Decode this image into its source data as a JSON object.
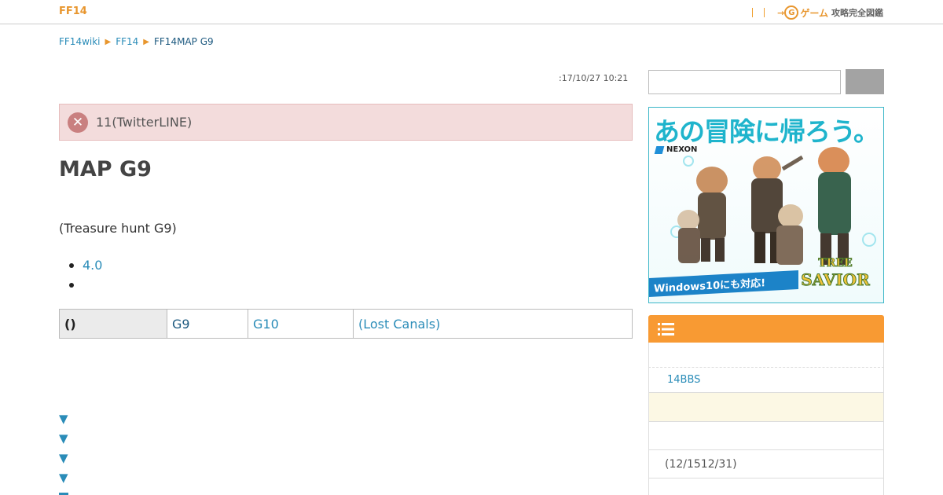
{
  "header": {
    "site_title": "FF14",
    "logo_text_game": "ゲーム",
    "logo_text_kanji": "攻略完全図鑑",
    "logo_circle_letter": "G"
  },
  "breadcrumb": {
    "items": [
      "FF14wiki",
      "FF14",
      "FF14MAP G9"
    ]
  },
  "main": {
    "timestamp": ":17/10/27 10:21",
    "alert_text": "11(TwitterLINE)",
    "page_title": "MAP G9",
    "subtitle": "(Treasure hunt G9)",
    "list": [
      "4.0",
      ""
    ],
    "map_table": {
      "head": "()",
      "current": "G9",
      "next": "G10",
      "location": "(Lost Canals)"
    },
    "nav_arrow": "▼"
  },
  "sidebar": {
    "search_placeholder": "",
    "ad": {
      "headline": "あの冒険に帰ろう。",
      "brand": "NEXON",
      "footer": "Windows10にも対応!",
      "game_title": "TREE OF SAVIOR"
    },
    "menu": {
      "rows": [
        "",
        "14BBS",
        "",
        "",
        "(12/1512/31)",
        ""
      ]
    }
  },
  "colors": {
    "accent_orange": "#f89a33",
    "link_blue": "#2a8cb8",
    "alert_bg": "#f3dcdc",
    "ad_cyan": "#1fb4cc"
  }
}
